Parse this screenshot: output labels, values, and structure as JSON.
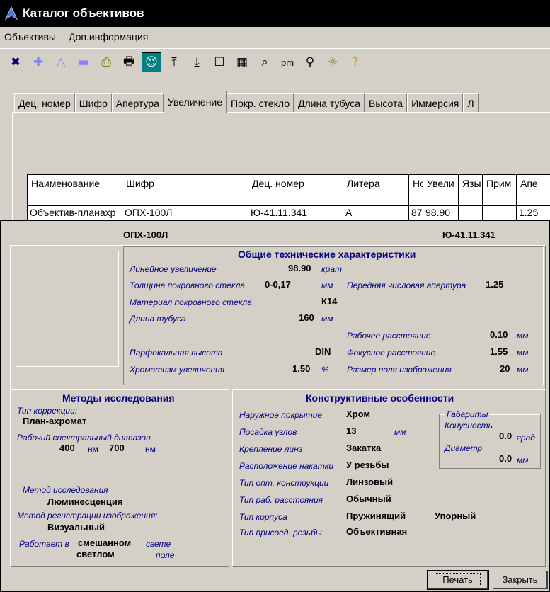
{
  "window": {
    "title": "Каталог объективов"
  },
  "menu": [
    "Объективы",
    "Доп.информация"
  ],
  "toolbar": {
    "items": [
      {
        "name": "delete-icon",
        "glyph": "✖",
        "color": "#000080"
      },
      {
        "name": "add-icon",
        "glyph": "✚",
        "color": "#8080ff"
      },
      {
        "name": "up-triangle-icon",
        "glyph": "△",
        "color": "#8080ff"
      },
      {
        "name": "minus-icon",
        "glyph": "▬",
        "color": "#8080ff"
      },
      {
        "name": "export-icon",
        "glyph": "⎙",
        "color": "#808000"
      },
      {
        "name": "print-icon",
        "glyph": "🖶",
        "color": "#000"
      },
      {
        "name": "portrait-icon",
        "glyph": "☺",
        "color": "#008080"
      },
      {
        "name": "first-record-icon",
        "glyph": "⤒",
        "color": "#000"
      },
      {
        "name": "last-record-icon",
        "glyph": "⤓",
        "color": "#000"
      },
      {
        "name": "checkbox-icon",
        "glyph": "☐",
        "color": "#000"
      },
      {
        "name": "calculator-icon",
        "glyph": "▦",
        "color": "#000"
      },
      {
        "name": "preview-icon",
        "glyph": "⌕",
        "color": "#000"
      },
      {
        "name": "pm-label",
        "glyph": "pm",
        "color": "#000"
      },
      {
        "name": "binoculars-icon",
        "glyph": "⚲",
        "color": "#000"
      },
      {
        "name": "settings-icon",
        "glyph": "☼",
        "color": "#808000"
      },
      {
        "name": "help-icon",
        "glyph": "?",
        "color": "#c0a000"
      }
    ]
  },
  "tabs": [
    "Дец. номер",
    "Шифр",
    "Апертура",
    "Увеличение",
    "Покр. стекло",
    "Длина тубуса",
    "Высота",
    "Иммерсия",
    "Л"
  ],
  "active_tab": "Увеличение",
  "grid": {
    "headers": [
      "Наименование",
      "Шифр",
      "Дец. номер",
      "Литера",
      "Но",
      "Увели",
      "Язы",
      "Прим",
      "Апе"
    ],
    "row": [
      "Объектив-планахр",
      "ОПХ-100Л",
      "Ю-41.11.341",
      "А",
      "87",
      "98.90",
      "",
      "",
      "1.25"
    ]
  },
  "dialog": {
    "code": "ОПХ-100Л",
    "dec_number": "Ю-41.11.341",
    "general": {
      "title": "Общие технические характеристики",
      "magnification_label": "Линейное увеличение",
      "magnification_value": "98.90",
      "magnification_unit": "крат",
      "cover_thickness_label": "Толщина покровного стекла",
      "cover_thickness_value": "0-0,17",
      "cover_thickness_unit": "мм",
      "aperture_label": "Передняя числовая апертура",
      "aperture_value": "1.25",
      "cover_material_label": "Материал покровного стекла",
      "cover_material_value": "К14",
      "tube_length_label": "Длина тубуса",
      "tube_length_value": "160",
      "tube_length_unit": "мм",
      "working_distance_label": "Рабочее расстояние",
      "working_distance_value": "0.10",
      "working_distance_unit": "мм",
      "parfocal_label": "Парфокальная высота",
      "parfocal_value": "DIN",
      "focal_distance_label": "Фокусное расстояние",
      "focal_distance_value": "1.55",
      "focal_distance_unit": "мм",
      "chromatism_label": "Хроматизм увеличения",
      "chromatism_value": "1.50",
      "chromatism_unit": "%",
      "field_size_label": "Размер поля изображения",
      "field_size_value": "20",
      "field_size_unit": "мм"
    },
    "methods": {
      "title": "Методы исследования",
      "correction_label": "Тип коррекции:",
      "correction_value": "План-ахромат",
      "spectral_label": "Рабочий спектральный диапазон",
      "spectral_from": "400",
      "spectral_unit1": "нм",
      "spectral_to": "700",
      "spectral_unit2": "нм",
      "method_label": "Метод исследования",
      "method_value": "Люминесценция",
      "registration_label": "Метод регистрации изображения:",
      "registration_value": "Визуальный",
      "works_label": "Работает в",
      "works_value1": "смешанном",
      "works_word2": "свете",
      "works_value2": "светлом",
      "works_word3": "поле"
    },
    "construction": {
      "title": "Конструктивные особенности",
      "coating_label": "Наружное покрытие",
      "coating_value": "Хром",
      "fitting_label": "Посадка узлов",
      "fitting_value": "13",
      "fitting_unit": "мм",
      "lens_mount_label": "Крепление линз",
      "lens_mount_value": "Закатка",
      "knurl_label": "Расположение накатки",
      "knurl_value": "У резьбы",
      "optics_label": "Тип опт. конструкции",
      "optics_value": "Линзовый",
      "wd_type_label": "Тип раб. расстояния",
      "wd_type_value": "Обычный",
      "body_label": "Тип корпуса",
      "body_value1": "Пружинящий",
      "body_value2": "Упорный",
      "thread_label": "Тип присоед. резьбы",
      "thread_value": "Объективная",
      "dims_title": "Габариты",
      "taper_label": "Конусность",
      "taper_value": "0.0",
      "taper_unit": "град",
      "diameter_label": "Диаметр",
      "diameter_value": "0.0",
      "diameter_unit": "мм"
    },
    "buttons": {
      "print": "Печать",
      "close": "Закрыть"
    }
  }
}
